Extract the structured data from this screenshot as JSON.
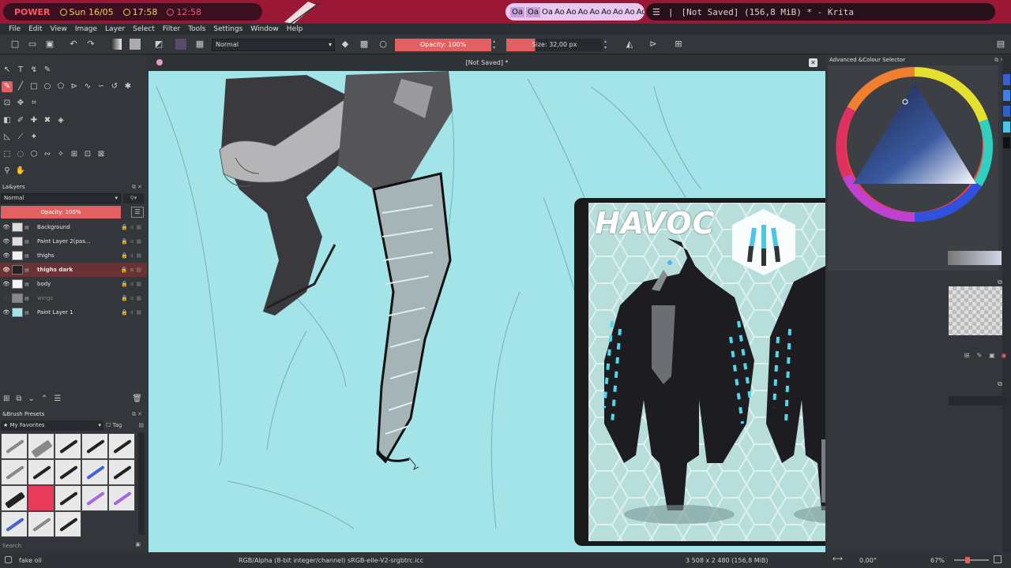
{
  "sysbar": {
    "power": "POWER",
    "date": "Sun 16/05",
    "time": "17:58",
    "timer": "12:58",
    "workspaces": [
      "Oa",
      "Oa",
      "Oa",
      "Ao",
      "Ao",
      "Ao",
      "Ao",
      "Ao",
      "Ao",
      "Ao",
      "Ao"
    ],
    "window_title": "[Not Saved]  (156,8 MiB)  * - Krita",
    "menu_glyph": "☰",
    "separator": "|"
  },
  "menu": [
    "File",
    "Edit",
    "View",
    "Image",
    "Layer",
    "Select",
    "Filter",
    "Tools",
    "Settings",
    "Window",
    "Help"
  ],
  "toolbar": {
    "blend_mode": "Normal",
    "opacity": "Opacity: 100%",
    "size": "Size: 32,00 px"
  },
  "layers_docker": {
    "title": "La&yers",
    "blend_mode": "Normal",
    "opacity": "Opacity:  100%",
    "rows": [
      {
        "name": "Background",
        "visible": true,
        "active": false
      },
      {
        "name": "Paint Layer 2(pas...",
        "visible": true,
        "active": false
      },
      {
        "name": "thighs",
        "visible": true,
        "active": false
      },
      {
        "name": "thighs dark",
        "visible": true,
        "active": true
      },
      {
        "name": "body",
        "visible": true,
        "active": false
      },
      {
        "name": "wings",
        "visible": false,
        "active": false
      },
      {
        "name": "Paint Layer 1",
        "visible": true,
        "active": false
      }
    ]
  },
  "brush_presets": {
    "title": "&Brush Presets",
    "tag": "★ My Favorites",
    "tag_button": "Tag",
    "search_placeholder": "Search"
  },
  "canvas": {
    "title": "[Not Saved]  *",
    "background": "#a3e4e8"
  },
  "reference": {
    "title": "HAVOC"
  },
  "colour_selector": {
    "title": "Advanced &Colour Selector"
  },
  "statusbar": {
    "preset": "fake oil",
    "color_space": "RGB/Alpha (8-bit integer/channel)  sRGB-elle-V2-srgbtrc.icc",
    "image_size": "3 508 x 2 480 (156,8 MiB)",
    "rotation": "0.00°",
    "zoom": "67%"
  },
  "colors": {
    "accent": "#e26060",
    "sysbar": "#9a1735",
    "active_layer": "#6b3236"
  }
}
